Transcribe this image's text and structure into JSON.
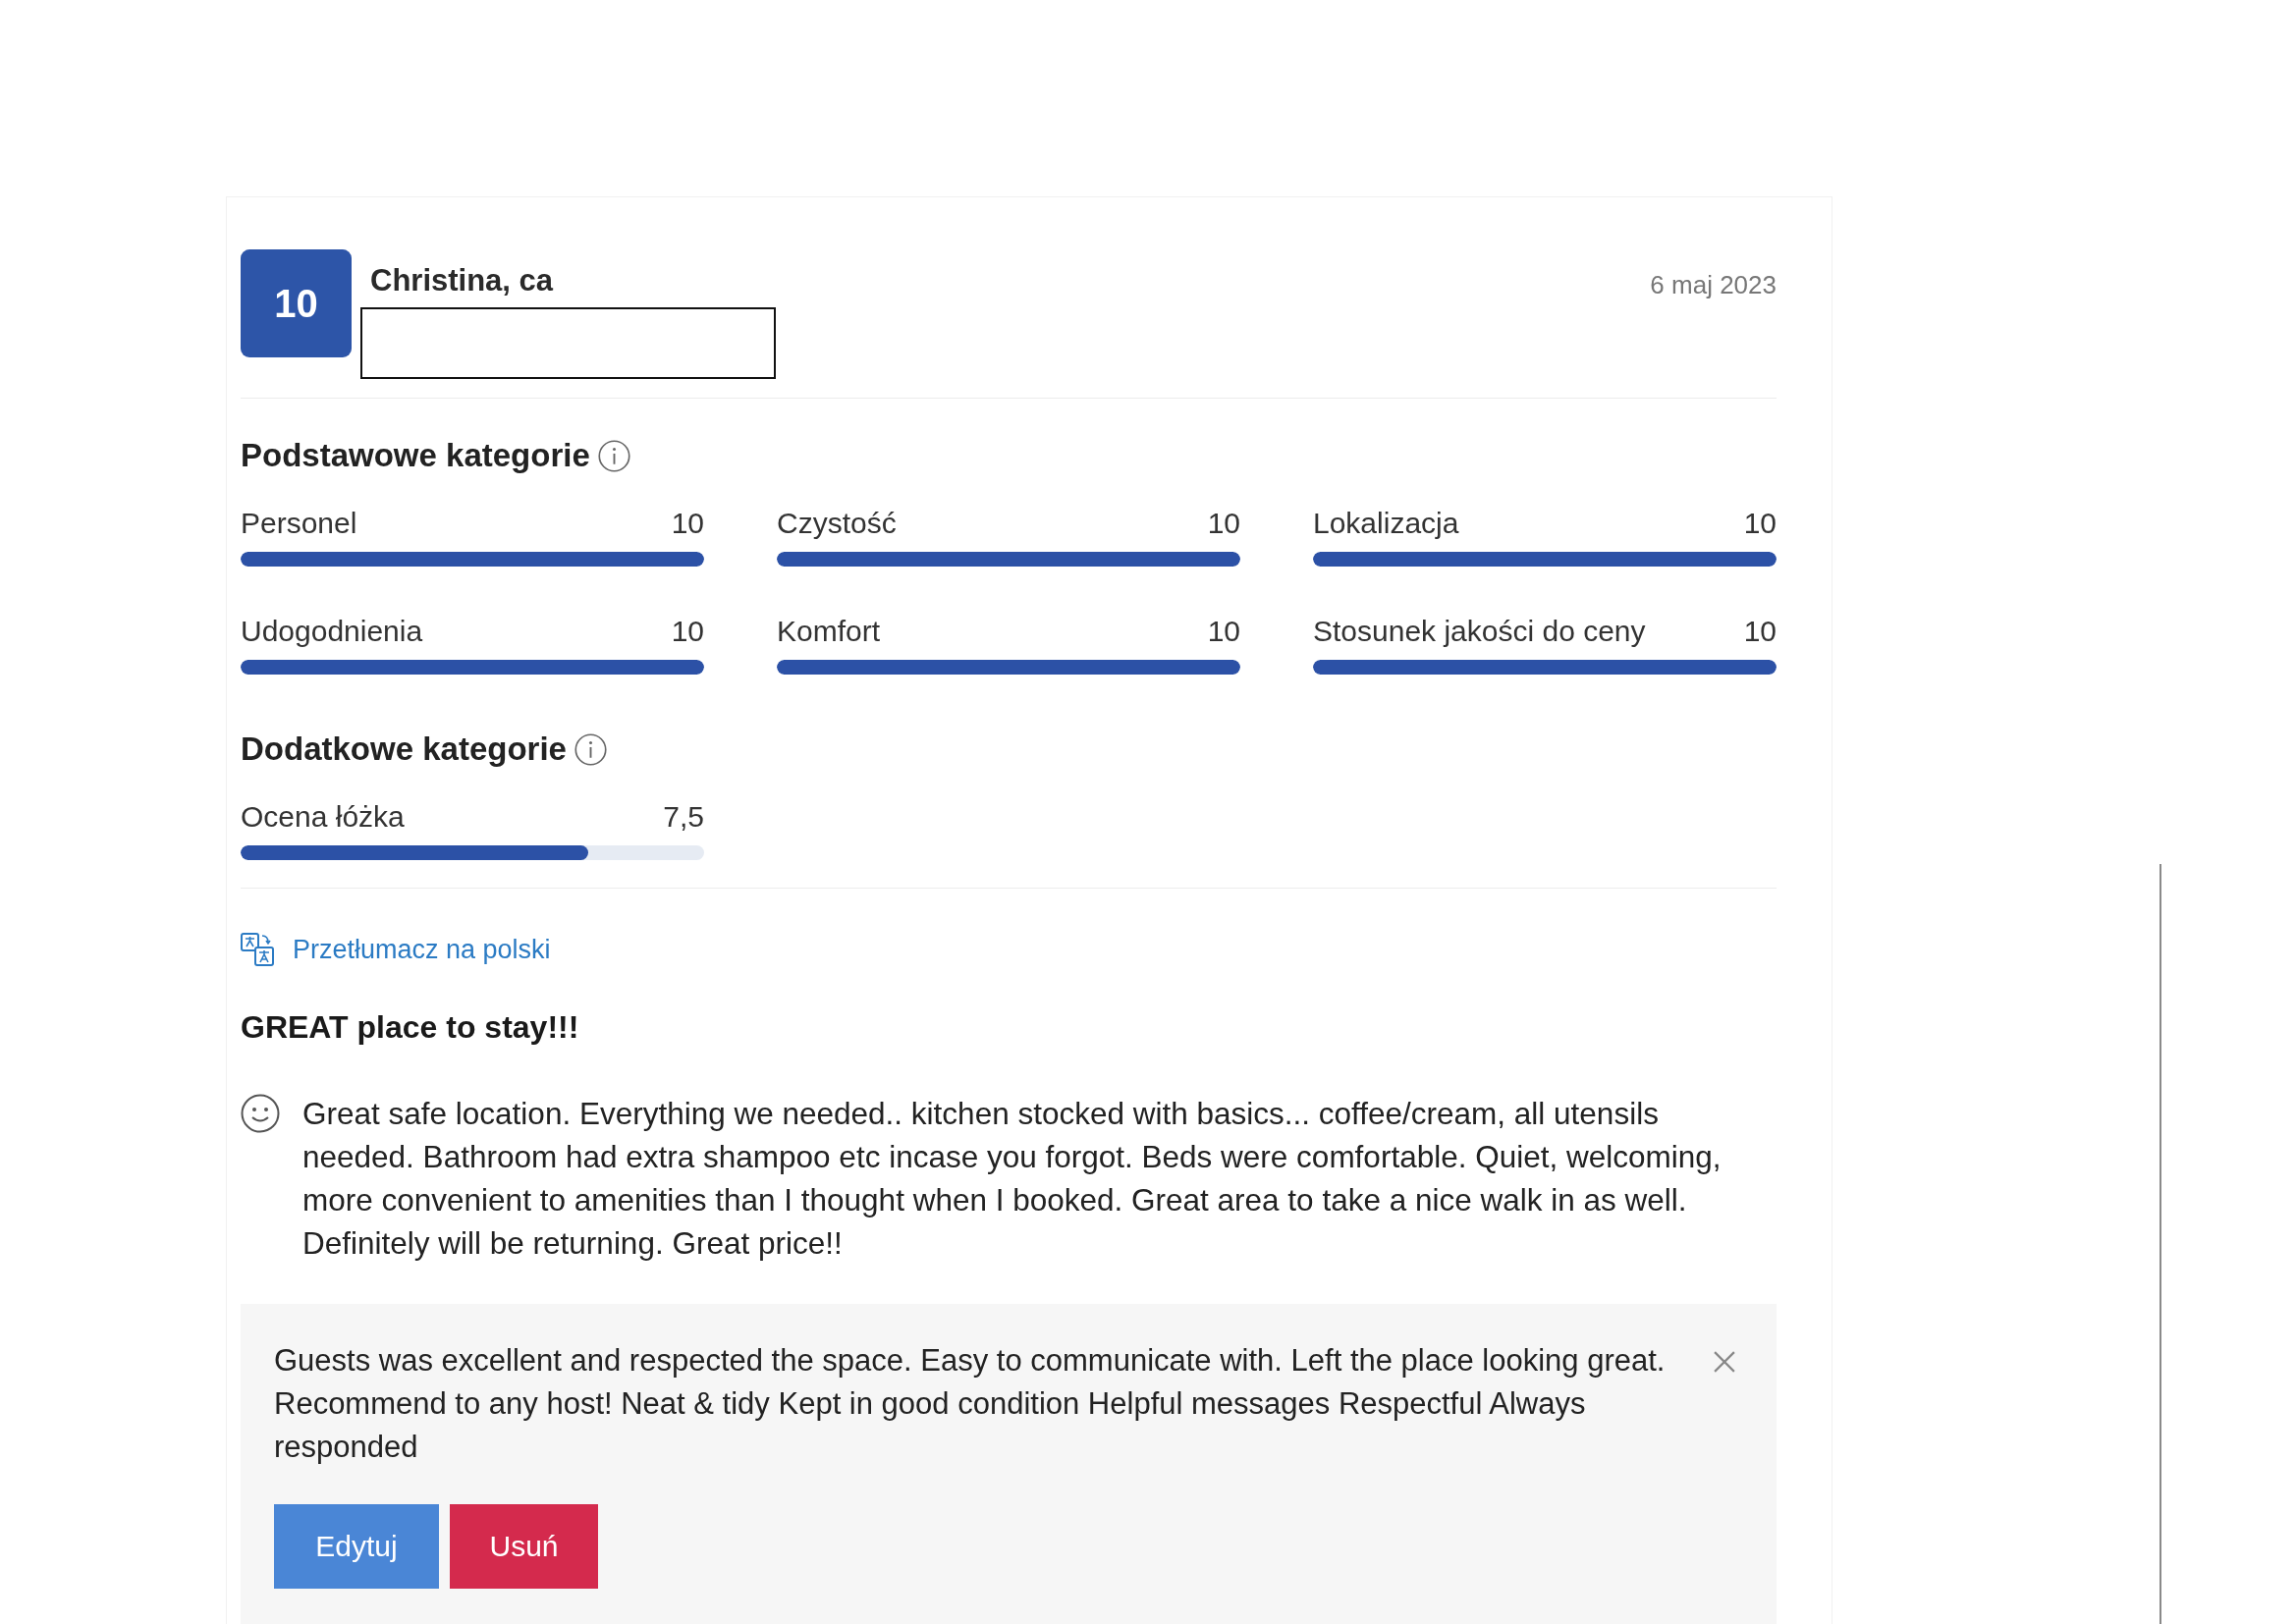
{
  "review": {
    "score": "10",
    "reviewer": "Christina, ca",
    "date": "6 maj 2023",
    "category_groups": [
      {
        "title": "Podstawowe kategorie",
        "items": [
          {
            "label": "Personel",
            "value": "10",
            "level": 1
          },
          {
            "label": "Czystość",
            "value": "10",
            "level": 1
          },
          {
            "label": "Lokalizacja",
            "value": "10",
            "level": 1
          },
          {
            "label": "Udogodnienia",
            "value": "10",
            "level": 1
          },
          {
            "label": "Komfort",
            "value": "10",
            "level": 1
          },
          {
            "label": "Stosunek jakości do ceny",
            "value": "10",
            "level": 1
          }
        ]
      },
      {
        "title": "Dodatkowe kategorie",
        "items": [
          {
            "label": "Ocena łóżka",
            "value": "7,5",
            "level": 0.75
          }
        ]
      }
    ],
    "translate_link": "Przetłumacz na polski",
    "title": "GREAT place to stay!!!",
    "text": "Great safe location. Everything we needed.. kitchen stocked with basics... coffee/cream, all utensils needed. Bathroom had extra shampoo etc incase you forgot. Beds were comfortable. Quiet, welcoming, more convenient to amenities than I thought when I booked. Great area to take a nice walk in as well. Definitely will be returning. Great price!!",
    "reply": {
      "text": "Guests was excellent and respected the space. Easy to communicate with. Left the place looking great. Recommend to any host! Neat & tidy Kept in good condition Helpful messages Respectful Always responded",
      "buttons": [
        {
          "label": "Edytuj",
          "kind": "edit"
        },
        {
          "label": "Usuń",
          "kind": "delete"
        }
      ]
    }
  }
}
